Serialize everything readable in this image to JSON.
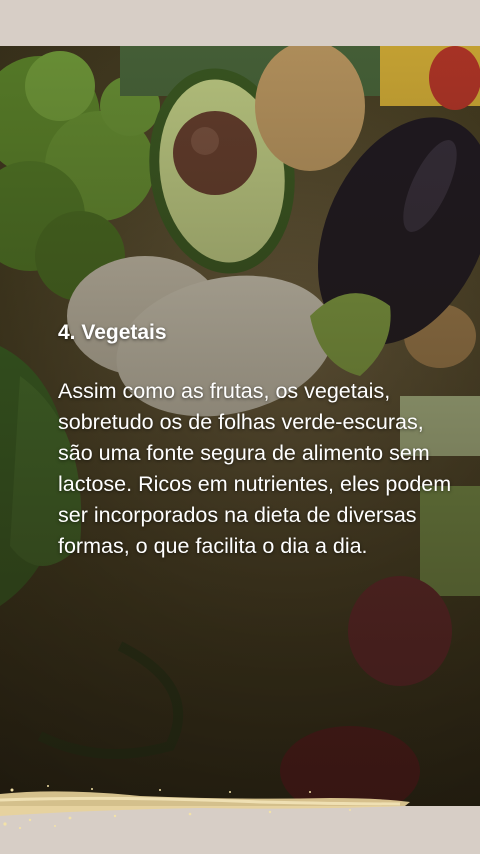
{
  "slide": {
    "title": "4. Vegetais",
    "body": "Assim como as frutas, os vegetais, sobretudo os de folhas verde-escuras, são uma fonte segura de alimento sem lactose. Ricos em nutrientes, eles podem ser incorporados na dieta de diversas formas, o que facilita o dia a dia."
  },
  "colors": {
    "page_background": "#d7cec6",
    "text": "#ffffff",
    "accent_gold": "#e8d39a"
  }
}
